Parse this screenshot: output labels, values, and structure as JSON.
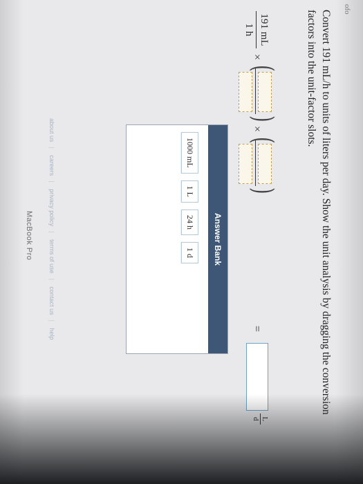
{
  "header": {
    "tag": "ofo"
  },
  "question": {
    "text": "Convert 191 mL/h to units of liters per day. Show the unit analysis by dragging the conversion factors into the unit-factor slots."
  },
  "expression": {
    "given_numerator": "191 mL",
    "given_denominator": "1 h",
    "times": "×",
    "equals": "=",
    "answer_unit_numerator": "L",
    "answer_unit_denominator": "d"
  },
  "answer_bank": {
    "title": "Answer Bank",
    "tiles": [
      "1000 mL",
      "1 L",
      "24 h",
      "1 d"
    ]
  },
  "footer": {
    "links": [
      "about us",
      "careers",
      "privacy policy",
      "terms of use",
      "contact us",
      "help"
    ]
  },
  "device": {
    "label": "MacBook Pro"
  }
}
